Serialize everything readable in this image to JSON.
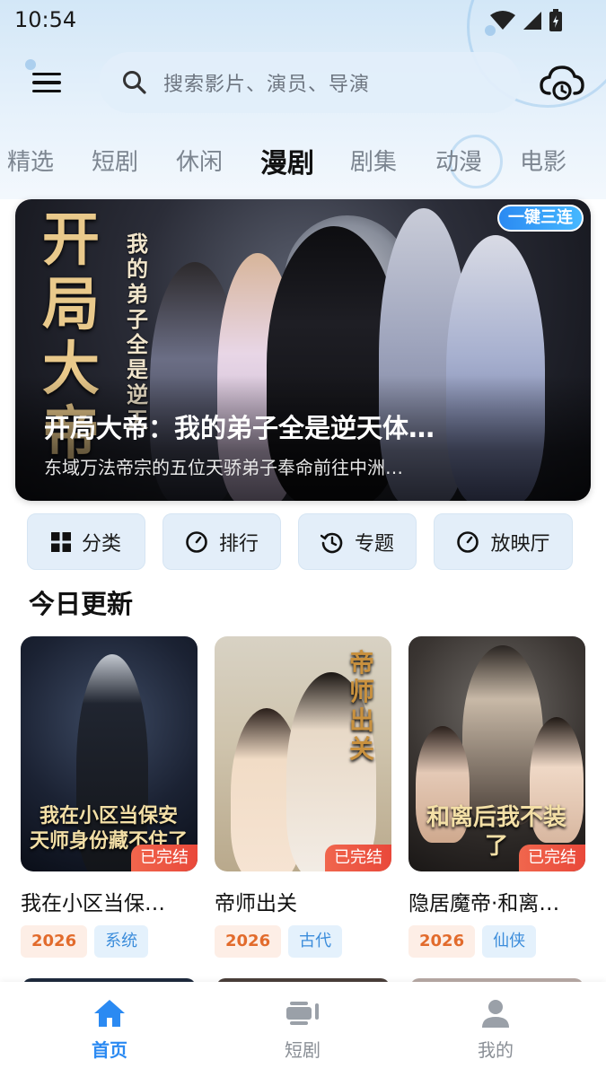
{
  "status_bar": {
    "time": "10:54"
  },
  "header": {
    "search_placeholder": "搜索影片、演员、导演"
  },
  "tabs": [
    {
      "label": "精选"
    },
    {
      "label": "短剧"
    },
    {
      "label": "休闲"
    },
    {
      "label": "漫剧",
      "active": true
    },
    {
      "label": "剧集"
    },
    {
      "label": "动漫"
    },
    {
      "label": "电影"
    }
  ],
  "banner": {
    "badge": "一键三连",
    "poster_title": "开局大帝",
    "poster_subtitle": "我的弟子全是逆天",
    "title": "开局大帝：我的弟子全是逆天体…",
    "description": "东域万法帝宗的五位天骄弟子奉命前往中洲…"
  },
  "quick_actions": [
    {
      "label": "分类",
      "icon": "grid-icon"
    },
    {
      "label": "排行",
      "icon": "circle-icon"
    },
    {
      "label": "专题",
      "icon": "history-icon"
    },
    {
      "label": "放映厅",
      "icon": "circle-icon"
    }
  ],
  "section_title": "今日更新",
  "cards": [
    {
      "title": "我在小区当保…",
      "status": "已完结",
      "year": "2026",
      "genre": "系统",
      "poster_text": "我在小区当保安 天师身份藏不住了"
    },
    {
      "title": "帝师出关",
      "status": "已完结",
      "year": "2026",
      "genre": "古代",
      "poster_text": "帝师出关"
    },
    {
      "title": "隐居魔帝·和离…",
      "status": "已完结",
      "year": "2026",
      "genre": "仙侠",
      "poster_text": "和离后我不装了"
    }
  ],
  "bottom_nav": [
    {
      "label": "首页",
      "active": true
    },
    {
      "label": "短剧"
    },
    {
      "label": "我的"
    }
  ],
  "colors": {
    "accent": "#2b8af2",
    "badge_red": "#e9483a",
    "year_tag": "#e26b2c",
    "genre_tag": "#3c8ddb"
  }
}
